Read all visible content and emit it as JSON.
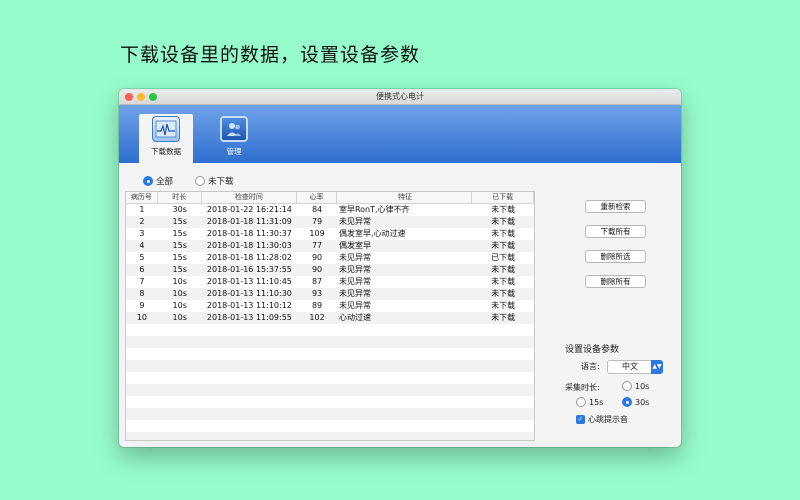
{
  "headline": "下载设备里的数据，设置设备参数",
  "window": {
    "title": "便携式心电计"
  },
  "toolbar": {
    "items": [
      {
        "label": "下载数据",
        "icon": "waveform-download-icon",
        "active": true
      },
      {
        "label": "管理",
        "icon": "users-manage-icon",
        "active": false
      }
    ]
  },
  "filter": {
    "all": "全部",
    "not_downloaded": "未下载",
    "selected": "全部"
  },
  "table": {
    "headers": [
      "病历号",
      "时长",
      "检查时间",
      "心率",
      "特征",
      "已下载"
    ],
    "rows": [
      [
        "1",
        "30s",
        "2018-01-22 16:21:14",
        "84",
        "室早RonT,心律不齐",
        "未下载"
      ],
      [
        "2",
        "15s",
        "2018-01-18 11:31:09",
        "79",
        "未见异常",
        "未下载"
      ],
      [
        "3",
        "15s",
        "2018-01-18 11:30:37",
        "109",
        "偶发室早,心动过速",
        "未下载"
      ],
      [
        "4",
        "15s",
        "2018-01-18 11:30:03",
        "77",
        "偶发室早",
        "未下载"
      ],
      [
        "5",
        "15s",
        "2018-01-18 11:28:02",
        "90",
        "未见异常",
        "已下载"
      ],
      [
        "6",
        "15s",
        "2018-01-16 15:37:55",
        "90",
        "未见异常",
        "未下载"
      ],
      [
        "7",
        "10s",
        "2018-01-13 11:10:45",
        "87",
        "未见异常",
        "未下载"
      ],
      [
        "8",
        "10s",
        "2018-01-13 11:10:30",
        "93",
        "未见异常",
        "未下载"
      ],
      [
        "9",
        "10s",
        "2018-01-13 11:10:12",
        "89",
        "未见异常",
        "未下载"
      ],
      [
        "10",
        "10s",
        "2018-01-13 11:09:55",
        "102",
        "心动过速",
        "未下载"
      ]
    ]
  },
  "buttons": {
    "refresh": "重新检索",
    "download_all": "下载所有",
    "delete_selected": "删除所选",
    "delete_all": "删除所有"
  },
  "settings": {
    "title": "设置设备参数",
    "language_label": "语言:",
    "language_value": "中文",
    "duration_label": "采集时长:",
    "duration_options": [
      "10s",
      "15s",
      "30s"
    ],
    "duration_selected": "30s",
    "beep_label": "心跳提示音",
    "beep_checked": true
  },
  "colors": {
    "background": "#97fccb",
    "toolbar": "#2f6fd0",
    "accent": "#2b78e4"
  }
}
